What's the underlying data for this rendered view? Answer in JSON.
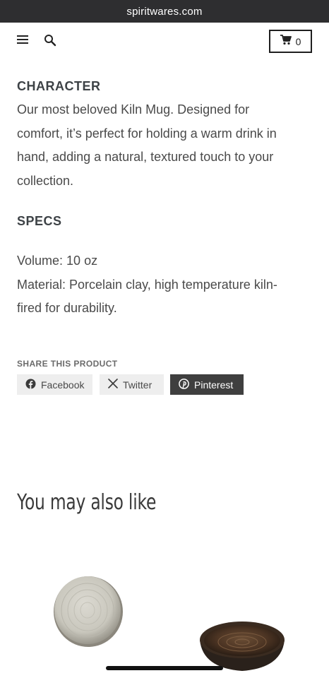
{
  "browser": {
    "url": "spiritwares.com"
  },
  "header": {
    "cart_count": "0"
  },
  "character": {
    "title": "CHARACTER",
    "lines": [
      "Our most beloved Kiln Mug. Designed for",
      "comfort, it’s perfect for holding a warm drink in",
      "hand, adding a natural, textured touch to your",
      "collection."
    ]
  },
  "specs": {
    "title": "SPECS",
    "lines": [
      "Volume: 10 oz",
      "Material: Porcelain clay, high temperature kiln-",
      "fired for durability."
    ]
  },
  "share": {
    "title": "SHARE THIS PRODUCT",
    "facebook": "Facebook",
    "twitter": "Twitter",
    "pinterest": "Pinterest"
  },
  "related": {
    "title": "You may also like"
  },
  "icons": [
    "menu-icon",
    "search-icon",
    "cart-icon",
    "facebook-icon",
    "x-twitter-icon",
    "pinterest-icon"
  ]
}
